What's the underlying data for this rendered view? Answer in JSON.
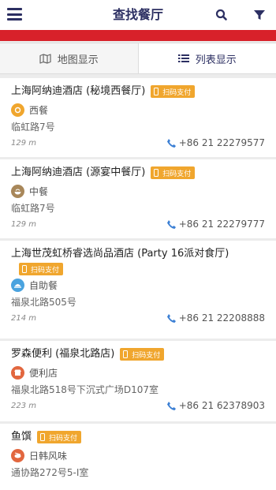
{
  "header": {
    "title": "查找餐厅"
  },
  "tabs": [
    {
      "label": "地图显示",
      "active": false
    },
    {
      "label": "列表显示",
      "active": true
    }
  ],
  "colors": {
    "brand": "#2c2f62",
    "accent_red": "#d8212a",
    "pay_badge": "#f0a62e",
    "phone": "#3b7fd4"
  },
  "restaurants": [
    {
      "name": "上海阿纳迪酒店 (秘境西餐厅)",
      "pay": "扫码支付",
      "category": "西餐",
      "category_icon": "western-food-icon",
      "address": "临虹路7号",
      "distance": "129 m",
      "phone": "+86 21 22279577"
    },
    {
      "name": "上海阿纳迪酒店 (源宴中餐厅)",
      "pay": "扫码支付",
      "category": "中餐",
      "category_icon": "chinese-food-icon",
      "address": "临虹路7号",
      "distance": "129 m",
      "phone": "+86 21 22279777"
    },
    {
      "name": "上海世茂虹桥睿选尚品酒店 (Party 16派对食厅)",
      "pay": "扫码支付",
      "category": "自助餐",
      "category_icon": "buffet-icon",
      "address": "福泉北路505号",
      "distance": "214 m",
      "phone": "+86 21 22208888"
    },
    {
      "name": "罗森便利 (福泉北路店)",
      "pay": "扫码支付",
      "category": "便利店",
      "category_icon": "store-icon",
      "address": "福泉北路518号下沉式广场D107室",
      "distance": "223 m",
      "phone": "+86 21 62378903"
    },
    {
      "name": "鱼馔",
      "pay": "扫码支付",
      "category": "日韩风味",
      "category_icon": "japanese-korean-food-icon",
      "address": "通协路272号5-I室",
      "distance": "",
      "phone": ""
    }
  ]
}
